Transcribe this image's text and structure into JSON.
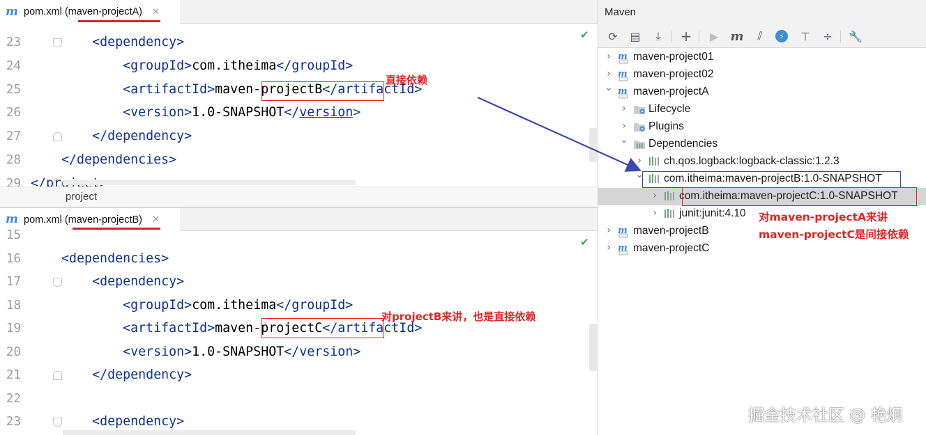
{
  "editorA": {
    "tab_label": "pom.xml (maven-projectA)",
    "lines": [
      {
        "no": "23",
        "parts": [
          {
            "t": "        "
          },
          {
            "t": "<",
            "c": "tag"
          },
          {
            "t": "dependency",
            "c": "tag"
          },
          {
            "t": ">",
            "c": "tag"
          }
        ]
      },
      {
        "no": "24",
        "parts": [
          {
            "t": "            "
          },
          {
            "t": "<groupId>",
            "c": "tag"
          },
          {
            "t": "com.itheima"
          },
          {
            "t": "</groupId>",
            "c": "tag"
          }
        ]
      },
      {
        "no": "25",
        "parts": [
          {
            "t": "            "
          },
          {
            "t": "<artifactId>",
            "c": "tag"
          },
          {
            "t": "maven-projectB"
          },
          {
            "t": "</artifactId>",
            "c": "tag"
          }
        ]
      },
      {
        "no": "26",
        "parts": [
          {
            "t": "            "
          },
          {
            "t": "<version>",
            "c": "tag"
          },
          {
            "t": "1.0-SNAPSHOT"
          },
          {
            "t": "</",
            "c": "tag"
          },
          {
            "t": "version",
            "c": "tag ul"
          },
          {
            "t": ">",
            "c": "tag"
          }
        ]
      },
      {
        "no": "27",
        "parts": [
          {
            "t": "        "
          },
          {
            "t": "</dependency>",
            "c": "tag"
          }
        ]
      },
      {
        "no": "28",
        "parts": [
          {
            "t": "    "
          },
          {
            "t": "</dependencies>",
            "c": "tag"
          }
        ]
      },
      {
        "no": "29",
        "parts": [
          {
            "t": "</project>",
            "c": "tag"
          }
        ]
      }
    ],
    "breadcrumb": "project",
    "annotation": "直接依赖"
  },
  "editorB": {
    "tab_label": "pom.xml (maven-projectB)",
    "lines": [
      {
        "no": "15",
        "parts": []
      },
      {
        "no": "16",
        "parts": [
          {
            "t": "    "
          },
          {
            "t": "<dependencies>",
            "c": "tag"
          }
        ]
      },
      {
        "no": "17",
        "parts": [
          {
            "t": "        "
          },
          {
            "t": "<dependency>",
            "c": "tag"
          }
        ]
      },
      {
        "no": "18",
        "parts": [
          {
            "t": "            "
          },
          {
            "t": "<groupId>",
            "c": "tag"
          },
          {
            "t": "com.itheima"
          },
          {
            "t": "</groupId>",
            "c": "tag"
          }
        ]
      },
      {
        "no": "19",
        "parts": [
          {
            "t": "            "
          },
          {
            "t": "<artifactId>",
            "c": "tag"
          },
          {
            "t": "maven-projectC"
          },
          {
            "t": "</artifactId>",
            "c": "tag"
          }
        ]
      },
      {
        "no": "20",
        "parts": [
          {
            "t": "            "
          },
          {
            "t": "<version>",
            "c": "tag"
          },
          {
            "t": "1.0-SNAPSHOT"
          },
          {
            "t": "</version>",
            "c": "tag"
          }
        ]
      },
      {
        "no": "21",
        "parts": [
          {
            "t": "        "
          },
          {
            "t": "</dependency>",
            "c": "tag"
          }
        ]
      },
      {
        "no": "22",
        "parts": []
      },
      {
        "no": "23",
        "parts": [
          {
            "t": "        "
          },
          {
            "t": "<dependency>",
            "c": "tag"
          }
        ]
      }
    ],
    "annotation": "对projectB来讲，也是直接依赖"
  },
  "maven": {
    "title": "Maven",
    "toolbar": [
      {
        "icon": "reload-icon",
        "glyph": "⟳"
      },
      {
        "icon": "add-folder-icon",
        "glyph": "▤"
      },
      {
        "icon": "download-icon",
        "glyph": "⤓"
      },
      {
        "icon": "plus-icon",
        "glyph": "+"
      },
      {
        "icon": "run-icon",
        "glyph": "▶"
      },
      {
        "icon": "execute-goal-icon",
        "glyph": "m"
      },
      {
        "icon": "toggle-offline-icon",
        "glyph": "⫽"
      },
      {
        "icon": "skip-tests-icon",
        "glyph": "⚡"
      },
      {
        "icon": "show-diagram-icon",
        "glyph": "⊤"
      },
      {
        "icon": "collapse-all-icon",
        "glyph": "÷"
      },
      {
        "icon": "settings-wrench-icon",
        "glyph": "🔧"
      }
    ],
    "tree": [
      {
        "label": "maven-project01",
        "icon": "maven-module-icon",
        "expanded": false
      },
      {
        "label": "maven-project02",
        "icon": "maven-module-icon",
        "expanded": false
      },
      {
        "label": "maven-projectA",
        "icon": "maven-module-icon",
        "expanded": true
      },
      {
        "label": "Lifecycle",
        "icon": "lifecycle-folder-icon",
        "expanded": false
      },
      {
        "label": "Plugins",
        "icon": "plugins-folder-icon",
        "expanded": false
      },
      {
        "label": "Dependencies",
        "icon": "dependencies-folder-icon",
        "expanded": true
      },
      {
        "label": "ch.qos.logback:logback-classic:1.2.3",
        "icon": "library-icon",
        "expanded": false
      },
      {
        "label": "com.itheima:maven-projectB:1.0-SNAPSHOT",
        "icon": "library-icon",
        "expanded": true
      },
      {
        "label": "com.itheima:maven-projectC:1.0-SNAPSHOT",
        "icon": "library-icon",
        "expanded": false,
        "selected": true
      },
      {
        "label": "junit:junit:4.10",
        "icon": "library-icon",
        "expanded": false
      },
      {
        "label": "maven-projectB",
        "icon": "maven-module-icon",
        "expanded": false
      },
      {
        "label": "maven-projectC",
        "icon": "maven-module-icon",
        "expanded": false
      }
    ],
    "annotation_line1": "对maven-projectA来讲",
    "annotation_line2": "maven-projectC是间接依赖"
  },
  "watermark": "掘金技术社区 @ 艳炯",
  "colors": {
    "annotation_red": "#e02424",
    "annotation_blue": "#3c48b4",
    "xml_tag": "#0c3296",
    "selected_row": "#d5d5d5"
  }
}
